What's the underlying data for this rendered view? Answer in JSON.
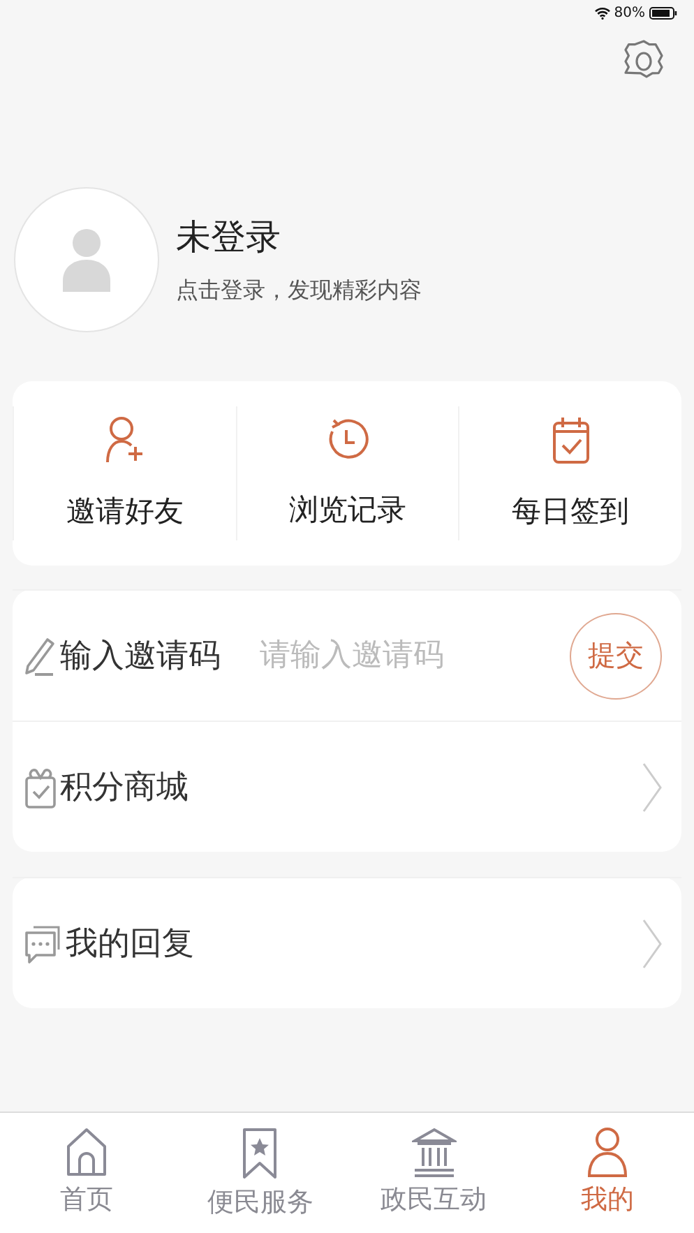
{
  "status_bar": {
    "battery": "80%"
  },
  "profile": {
    "name": "未登录",
    "subtitle": "点击登录，发现精彩内容"
  },
  "quick_actions": [
    {
      "label": "邀请好友",
      "kind": "invite"
    },
    {
      "label": "浏览记录",
      "kind": "history"
    },
    {
      "label": "每日签到",
      "kind": "checkin"
    }
  ],
  "menu_groups": [
    {
      "items": [
        {
          "kind": "code",
          "label": "输入邀请码",
          "placeholder": "请输入邀请码",
          "button": "提交"
        },
        {
          "kind": "mall",
          "label": "积分商城"
        }
      ]
    },
    {
      "items": [
        {
          "kind": "replies",
          "label": "我的回复"
        }
      ]
    }
  ],
  "tabs": [
    {
      "label": "首页",
      "selected": false
    },
    {
      "label": "便民服务",
      "selected": false
    },
    {
      "label": "政民互动",
      "selected": false
    },
    {
      "label": "我的",
      "selected": true
    }
  ]
}
